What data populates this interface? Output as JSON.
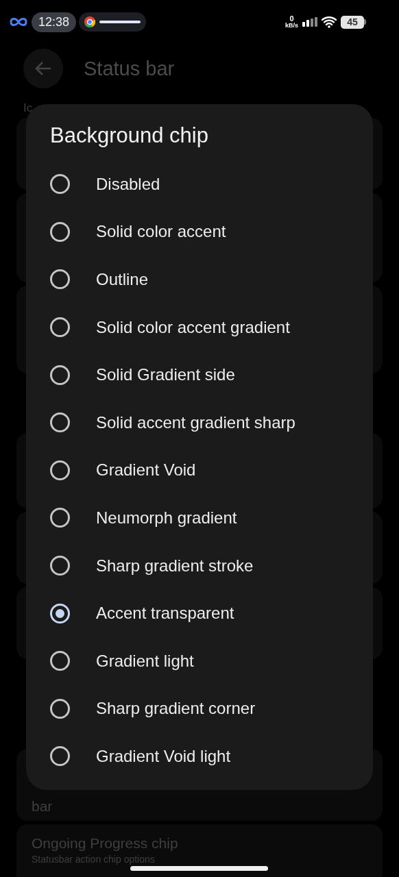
{
  "status_bar": {
    "time": "12:38",
    "net_speed_value": "0",
    "net_speed_unit": "kB/s",
    "battery": "45"
  },
  "header": {
    "title": "Status bar"
  },
  "background": {
    "section_label": "Ic",
    "cards": [
      {
        "lines": [
          "bar"
        ]
      },
      {
        "lines": [
          "Ongoing Progress chip",
          "Statusbar action chip options"
        ]
      }
    ]
  },
  "dialog": {
    "title": "Background chip",
    "options": [
      {
        "label": "Disabled",
        "selected": false
      },
      {
        "label": "Solid color accent",
        "selected": false
      },
      {
        "label": "Outline",
        "selected": false
      },
      {
        "label": "Solid color accent gradient",
        "selected": false
      },
      {
        "label": "Solid Gradient side",
        "selected": false
      },
      {
        "label": "Solid accent gradient sharp",
        "selected": false
      },
      {
        "label": "Gradient Void",
        "selected": false
      },
      {
        "label": "Neumorph gradient",
        "selected": false
      },
      {
        "label": "Sharp gradient stroke",
        "selected": false
      },
      {
        "label": "Accent transparent",
        "selected": true
      },
      {
        "label": "Gradient light",
        "selected": false
      },
      {
        "label": "Sharp gradient corner",
        "selected": false
      },
      {
        "label": "Gradient Void light",
        "selected": false
      }
    ]
  }
}
